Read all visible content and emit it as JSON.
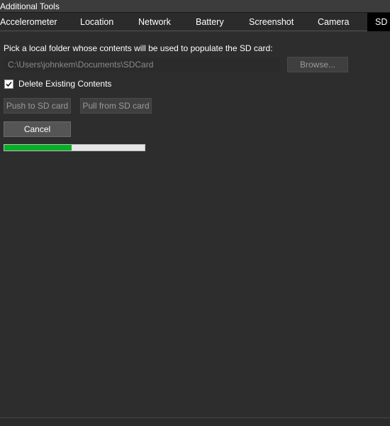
{
  "window": {
    "title": "Additional Tools"
  },
  "tabs": [
    {
      "label": "Accelerometer",
      "active": false
    },
    {
      "label": "Location",
      "active": false
    },
    {
      "label": "Network",
      "active": false
    },
    {
      "label": "Battery",
      "active": false
    },
    {
      "label": "Screenshot",
      "active": false
    },
    {
      "label": "Camera",
      "active": false
    },
    {
      "label": "SD Card",
      "active": true
    }
  ],
  "sd_card": {
    "prompt": "Pick a local folder whose contents will be used to populate the SD card:",
    "folder_path": "C:\\Users\\johnkem\\Documents\\SDCard",
    "browse_label": "Browse...",
    "delete_existing_label": "Delete Existing Contents",
    "delete_existing_checked": true,
    "push_label": "Push to SD card",
    "pull_label": "Pull from SD card",
    "cancel_label": "Cancel",
    "progress_percent": 48
  },
  "colors": {
    "background": "#2b2b2b",
    "progress_fill": "#06b025",
    "progress_track": "#e6e6e6",
    "active_tab": "#000000"
  }
}
